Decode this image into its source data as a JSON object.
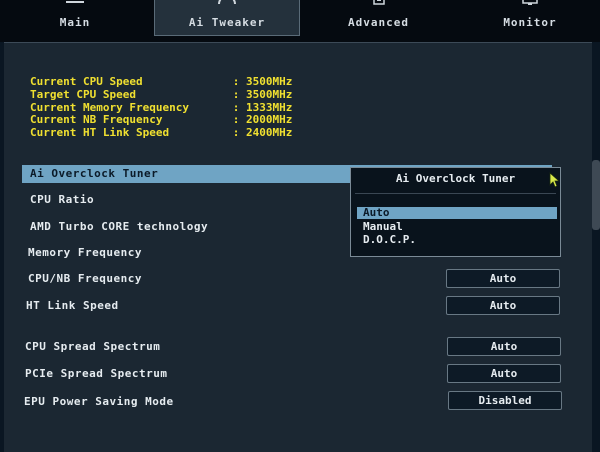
{
  "tabs": [
    {
      "label": "Main",
      "icon": "list-icon",
      "active": false
    },
    {
      "label": "Ai Tweaker",
      "icon": "gauge-icon",
      "active": true
    },
    {
      "label": "Advanced",
      "icon": "chip-icon",
      "active": false
    },
    {
      "label": "Monitor",
      "icon": "monitor-icon",
      "active": false
    }
  ],
  "info": [
    {
      "label": "Current CPU Speed",
      "sep": ":",
      "value": "3500MHz"
    },
    {
      "label": "Target CPU Speed",
      "sep": ":",
      "value": "3500MHz"
    },
    {
      "label": "Current Memory Frequency",
      "sep": ":",
      "value": "1333MHz"
    },
    {
      "label": "Current NB Frequency",
      "sep": ":",
      "value": "2000MHz"
    },
    {
      "label": "Current HT Link Speed",
      "sep": ":",
      "value": "2400MHz"
    }
  ],
  "settings": [
    {
      "label": "Ai Overclock Tuner"
    },
    {
      "label": "CPU Ratio"
    },
    {
      "label": "AMD Turbo CORE technology"
    },
    {
      "label": "Memory Frequency"
    },
    {
      "label": "CPU/NB Frequency",
      "value": "Auto"
    },
    {
      "label": "HT Link Speed",
      "value": "Auto"
    },
    {
      "label": "CPU Spread Spectrum",
      "value": "Auto"
    },
    {
      "label": "PCIe Spread Spectrum",
      "value": "Auto"
    },
    {
      "label": "EPU Power Saving Mode",
      "value": "Disabled"
    }
  ],
  "popup": {
    "title": "Ai Overclock Tuner",
    "options": [
      "Auto",
      "Manual",
      "D.O.C.P."
    ],
    "highlighted": "Auto"
  },
  "colors": {
    "info_text": "#f0e030",
    "highlight": "#6fa4c4",
    "background": "#1b2732"
  }
}
